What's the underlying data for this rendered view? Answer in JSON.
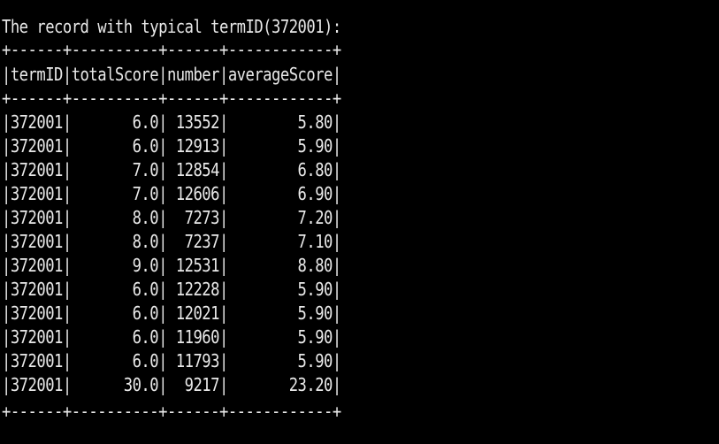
{
  "terminal": {
    "heading": "The record with typical termID(372001):",
    "border": "+------+----------+------+------------+",
    "header_row": "|termID|totalScore|number|averageScore|",
    "rows": [
      "|372001|       6.0| 13552|        5.80|",
      "|372001|       6.0| 12913|        5.90|",
      "|372001|       7.0| 12854|        6.80|",
      "|372001|       7.0| 12606|        6.90|",
      "|372001|       8.0|  7273|        7.20|",
      "|372001|       8.0|  7237|        7.10|",
      "|372001|       9.0| 12531|        8.80|",
      "|372001|       6.0| 12228|        5.90|",
      "|372001|       6.0| 12021|        5.90|",
      "|372001|       6.0| 11960|        5.90|",
      "|372001|       6.0| 11793|        5.90|",
      "|372001|      30.0|  9217|       23.20|"
    ]
  }
}
